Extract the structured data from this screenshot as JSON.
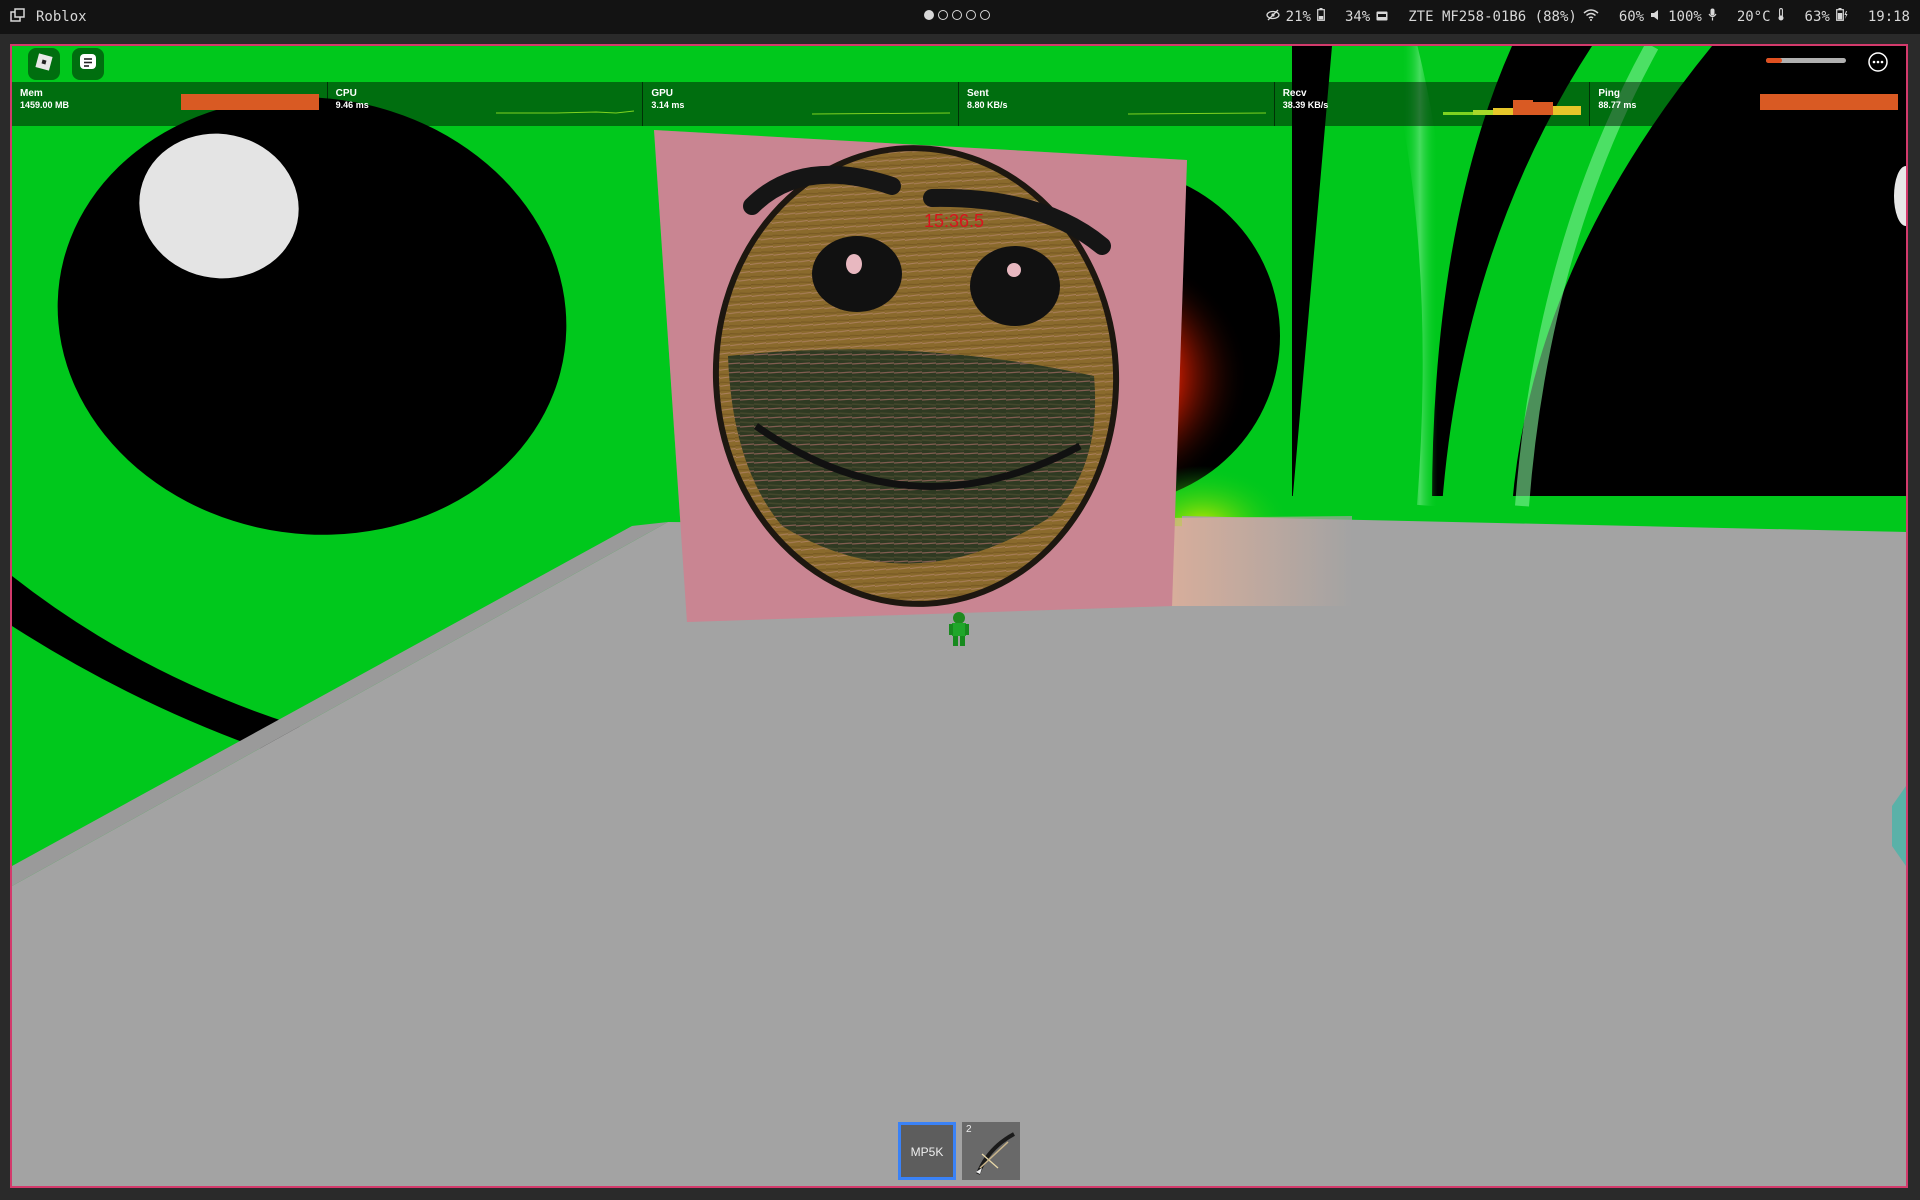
{
  "topbar": {
    "app_title": "Roblox",
    "workspaces": [
      true,
      false,
      false,
      false,
      false
    ],
    "privacy_pct": "21%",
    "battery_pct": "34%",
    "wifi_name": "ZTE MF258-01B6 (88%)",
    "brightness_pct": "60%",
    "volume_pct": "100%",
    "temperature": "20°C",
    "battery2_pct": "63%",
    "clock": "19:18"
  },
  "stats": [
    {
      "label": "Mem",
      "value": "1459.00 MB"
    },
    {
      "label": "CPU",
      "value": "9.46 ms"
    },
    {
      "label": "GPU",
      "value": "3.14 ms"
    },
    {
      "label": "Sent",
      "value": "8.80 KB/s"
    },
    {
      "label": "Recv",
      "value": "38.39 KB/s"
    },
    {
      "label": "Ping",
      "value": "88.77 ms"
    }
  ],
  "scene": {
    "floating_text": "15:36.5"
  },
  "hotbar": {
    "slots": [
      {
        "name": "MP5K",
        "number": "",
        "selected": true
      },
      {
        "name": "",
        "number": "2",
        "selected": false,
        "icon": "bow-icon"
      }
    ]
  },
  "colors": {
    "window_border": "#d33a6c",
    "green": "#00c81c",
    "floor": "#a3a3a3",
    "stat_bar": "#d95a23",
    "selected_slot": "#3a82f7"
  }
}
